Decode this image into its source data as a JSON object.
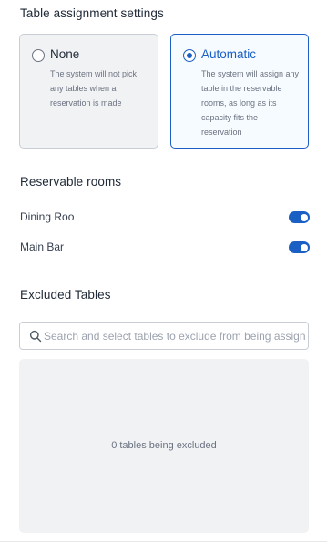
{
  "table_assignment": {
    "title": "Table assignment settings",
    "options": [
      {
        "label": "None",
        "description": "The system will not pick any tables when a reservation is made",
        "selected": false
      },
      {
        "label": "Automatic",
        "description": "The system will assign any table in the reservable rooms, as long as its capacity fits the reservation",
        "selected": true
      }
    ]
  },
  "reservable_rooms": {
    "title": "Reservable rooms",
    "rooms": [
      {
        "label": "Dining Roo",
        "enabled": true
      },
      {
        "label": "Main Bar",
        "enabled": true
      }
    ]
  },
  "excluded_tables": {
    "title": "Excluded Tables",
    "search_placeholder": "Search and select tables to exclude from being assigned",
    "empty_text": "0 tables being excluded"
  },
  "colors": {
    "accent": "#1a5fc4",
    "selected_card_bg": "#f6fbff",
    "unselected_card_bg": "#f1f2f4"
  }
}
